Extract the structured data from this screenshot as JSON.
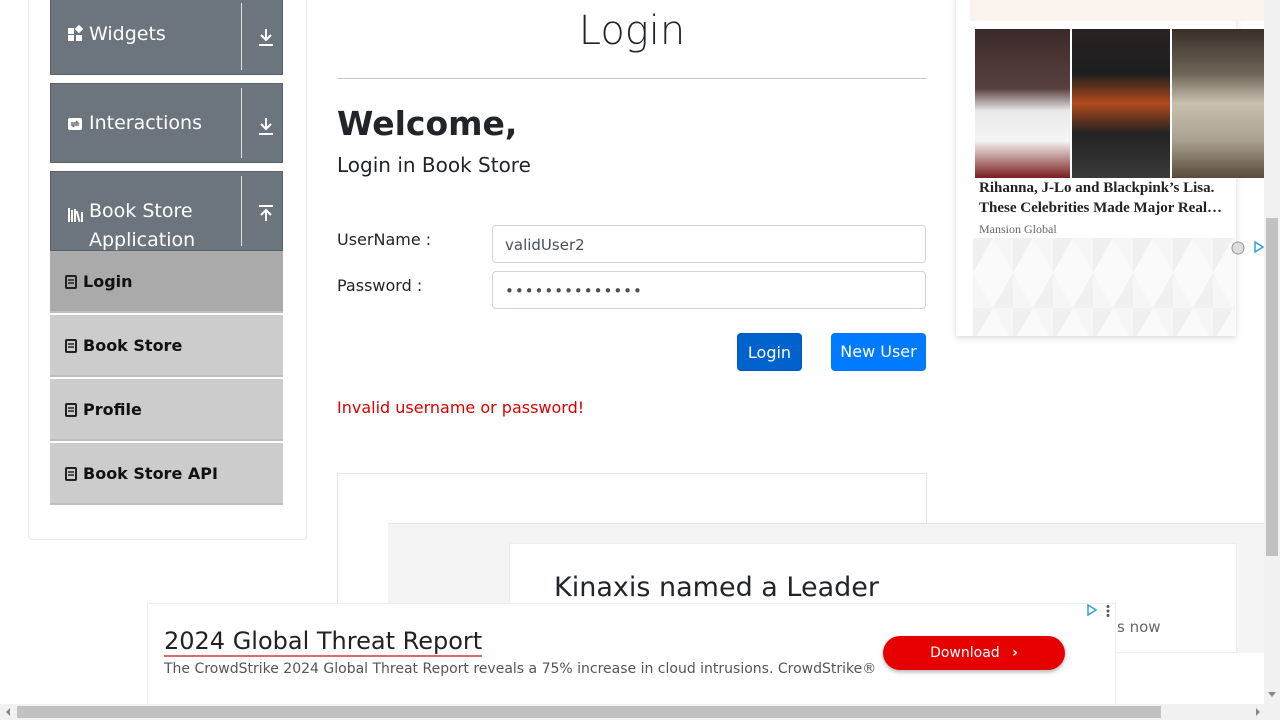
{
  "nav": {
    "groups": [
      {
        "label": "Widgets",
        "icon": "grid-icon",
        "state": "collapsed"
      },
      {
        "label": "Interactions",
        "icon": "interaction-icon",
        "state": "collapsed"
      },
      {
        "label": "Book Store",
        "label2": "Application",
        "icon": "books-icon",
        "state": "expanded"
      }
    ],
    "book_store_items": [
      {
        "label": "Login",
        "active": true
      },
      {
        "label": "Book Store"
      },
      {
        "label": "Profile"
      },
      {
        "label": "Book Store API"
      }
    ]
  },
  "main": {
    "title": "Login",
    "welcome": "Welcome,",
    "subtitle": "Login in Book Store",
    "username_label": "UserName :",
    "username_value": "validUser2",
    "password_label": "Password :",
    "password_value": "••••••••••••••",
    "login_button": "Login",
    "new_user_button": "New User",
    "error": "Invalid username or password!"
  },
  "content_ad": {
    "headline": "Kinaxis named a Leader",
    "partial_text": "s now"
  },
  "right_ad": {
    "caption": "Rihanna, J-Lo and Blackpink’s Lisa. These Celebrities Made Major Real…",
    "source": "Mansion Global"
  },
  "bottom_ad": {
    "title": "2024 Global Threat Report",
    "description": "The CrowdStrike 2024 Global Threat Report reveals a 75% increase in cloud intrusions. CrowdStrike®",
    "button": "Download"
  },
  "colors": {
    "nav_group": "#6c757d",
    "nav_item": "#cccccc",
    "nav_item_active": "#aaaaaa",
    "primary": "#007bff",
    "error": "#dd0000",
    "ad_button": "#e60000"
  }
}
